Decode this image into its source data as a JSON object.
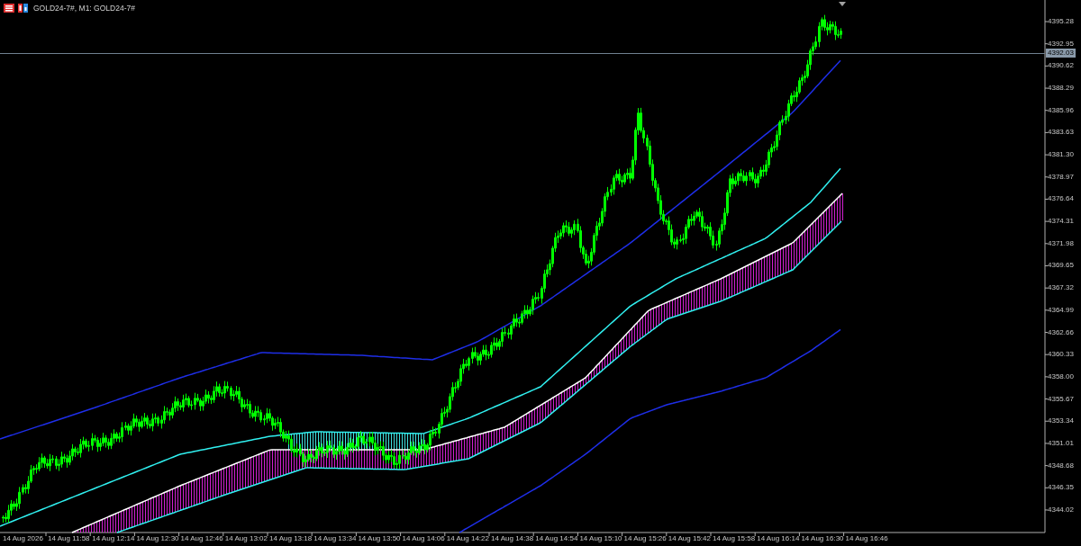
{
  "window": {
    "title": "GOLD24-7#, M1:  GOLD24-7#"
  },
  "chart": {
    "current_price": "4392.03",
    "price_axis": [
      "4395.28",
      "4392.95",
      "4390.62",
      "4388.29",
      "4385.96",
      "4383.63",
      "4381.30",
      "4378.97",
      "4376.64",
      "4374.31",
      "4371.98",
      "4369.65",
      "4367.32",
      "4364.99",
      "4362.66",
      "4360.33",
      "4358.00",
      "4355.67",
      "4353.34",
      "4351.01",
      "4348.68",
      "4346.35",
      "4344.02"
    ],
    "time_axis": [
      "14 Aug 2026",
      "14 Aug 11:58",
      "14 Aug 12:14",
      "14 Aug 12:30",
      "14 Aug 12:46",
      "14 Aug 13:02",
      "14 Aug 13:18",
      "14 Aug 13:34",
      "14 Aug 13:50",
      "14 Aug 14:06",
      "14 Aug 14:22",
      "14 Aug 14:38",
      "14 Aug 14:54",
      "14 Aug 15:10",
      "14 Aug 15:26",
      "14 Aug 15:42",
      "14 Aug 15:58",
      "14 Aug 16:14",
      "14 Aug 16:30",
      "14 Aug 16:46"
    ]
  }
}
